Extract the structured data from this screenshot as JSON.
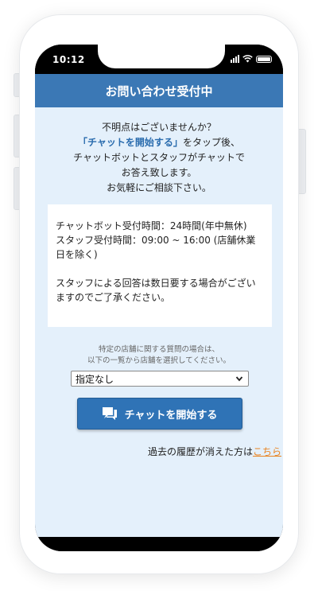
{
  "status_bar": {
    "time": "10:12"
  },
  "header": {
    "title": "お問い合わせ受付中"
  },
  "intro": {
    "line1": "不明点はございませんか？",
    "line2_highlight": "「チャットを開始する」",
    "line2_rest": "をタップ後、",
    "line3": "チャットボットとスタッフがチャットで",
    "line4": "お答え致します。",
    "line5": "お気軽にご相談下さい。"
  },
  "info": {
    "line1": "チャットボット受付時間：24時間(年中無休)",
    "line2": "スタッフ受付時間：09:00 ~ 16:00 (店舗休業日を除く)",
    "line3": "スタッフによる回答は数日要する場合がございますのでご了承ください。"
  },
  "store_note": {
    "line1": "特定の店舗に関する質問の場合は、",
    "line2": "以下の一覧から店舗を選択してください。"
  },
  "store_select": {
    "selected": "指定なし"
  },
  "start_button": {
    "label": "チャットを開始する"
  },
  "history": {
    "text": "過去の履歴が消えた方は",
    "link": "こちら"
  },
  "colors": {
    "header": "#3b78b5",
    "content_bg": "#e4f0fb",
    "button": "#2f73b6",
    "link": "#e98320"
  },
  "icons": {
    "chat": "chat-bubble-icon",
    "select_arrow": "chevron-down-icon"
  }
}
